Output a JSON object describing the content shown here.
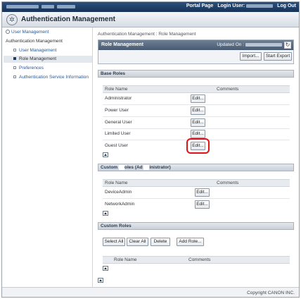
{
  "topbar": {
    "portal_label": "Portal Page",
    "login_label": "Login User:",
    "logout_label": "Log Out"
  },
  "header": {
    "title": "Authentication Management"
  },
  "sidebar": {
    "top_link": "User Management",
    "section_heading": "Authentication Management",
    "items": [
      {
        "label": "User Management"
      },
      {
        "label": "Role Management"
      },
      {
        "label": "Preferences"
      },
      {
        "label": "Authentication Service Information"
      }
    ]
  },
  "main": {
    "breadcrumb": "Authentication Management : Role Management",
    "page_title": "Role Management",
    "updated_label": "Updated On :",
    "import_label": "Import...",
    "start_export_label": "Start Export",
    "base_roles": {
      "title": "Base Roles",
      "col_name": "Role Name",
      "col_comments": "Comments",
      "rows": [
        {
          "name": "Administrator",
          "edit": "Edit..."
        },
        {
          "name": "Power User",
          "edit": "Edit..."
        },
        {
          "name": "General User",
          "edit": "Edit..."
        },
        {
          "name": "Limited User",
          "edit": "Edit..."
        },
        {
          "name": "Guest User",
          "edit": "Edit..."
        }
      ]
    },
    "custom_admin": {
      "title_a": "Custom",
      "title_b": "oles (Ad",
      "title_c": "inistrator)",
      "col_name": "Role Name",
      "col_comments": "Comments",
      "rows": [
        {
          "name": "DeviceAdmin",
          "edit": "Edit..."
        },
        {
          "name": "NetworkAdmin",
          "edit": "Edit..."
        }
      ]
    },
    "custom_roles": {
      "title": "Custom Roles",
      "select_all": "Select All",
      "clear_all": "Clear All",
      "delete": "Delete",
      "add_role": "Add Role...",
      "col_name": "Role Name",
      "col_comments": "Comments"
    }
  },
  "footer": {
    "copyright": "Copyright CANON INC."
  },
  "colors": {
    "highlight": "#e0121a",
    "topbar": "#1f3d66"
  }
}
